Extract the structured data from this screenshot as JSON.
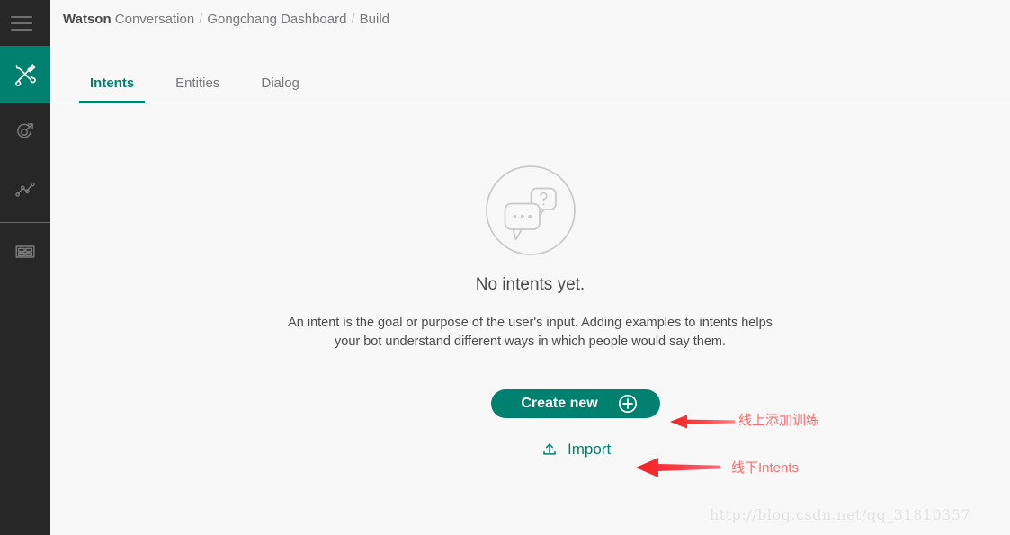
{
  "window": {
    "title": "Watson Conversation - Build",
    "bg_color": "#f8f8f8",
    "accent_color": "#00806f",
    "annotation_color": "#fb6a6e"
  },
  "rail": {
    "menu_icon": "hamburger-menu-icon",
    "items": [
      {
        "id": "build",
        "icon": "tools-wrench-screwdriver-icon",
        "active": true
      },
      {
        "id": "improve",
        "icon": "target-arrow-icon",
        "active": false
      },
      {
        "id": "analytics",
        "icon": "line-chart-icon",
        "active": false
      },
      {
        "id": "deploy",
        "icon": "grid-table-icon",
        "active": false
      }
    ]
  },
  "breadcrumb": {
    "brand_strong": "Watson",
    "brand_rest": "Conversation",
    "separator": "/",
    "items": [
      {
        "label": "Gongchang Dashboard"
      },
      {
        "label": "Build"
      }
    ]
  },
  "tabs": [
    {
      "label": "Intents",
      "active": true
    },
    {
      "label": "Entities",
      "active": false
    },
    {
      "label": "Dialog",
      "active": false
    }
  ],
  "empty_state": {
    "illustration": "speech-bubbles-question-circle-illustration",
    "title": "No intents yet.",
    "description": "An intent is the goal or purpose of the user's input. Adding examples to intents helps your bot understand different ways in which people would say them."
  },
  "actions": {
    "create_label": "Create new",
    "create_icon": "plus-circle-icon",
    "import_label": "Import",
    "import_icon": "upload-icon"
  },
  "annotations": [
    {
      "id": "create-new",
      "arrow": "left-arrow",
      "text": "线上添加训练"
    },
    {
      "id": "import",
      "arrow": "left-arrow",
      "text": "线下Intents"
    }
  ],
  "watermark": {
    "text": "http://blog.csdn.net/qq_31810357"
  }
}
